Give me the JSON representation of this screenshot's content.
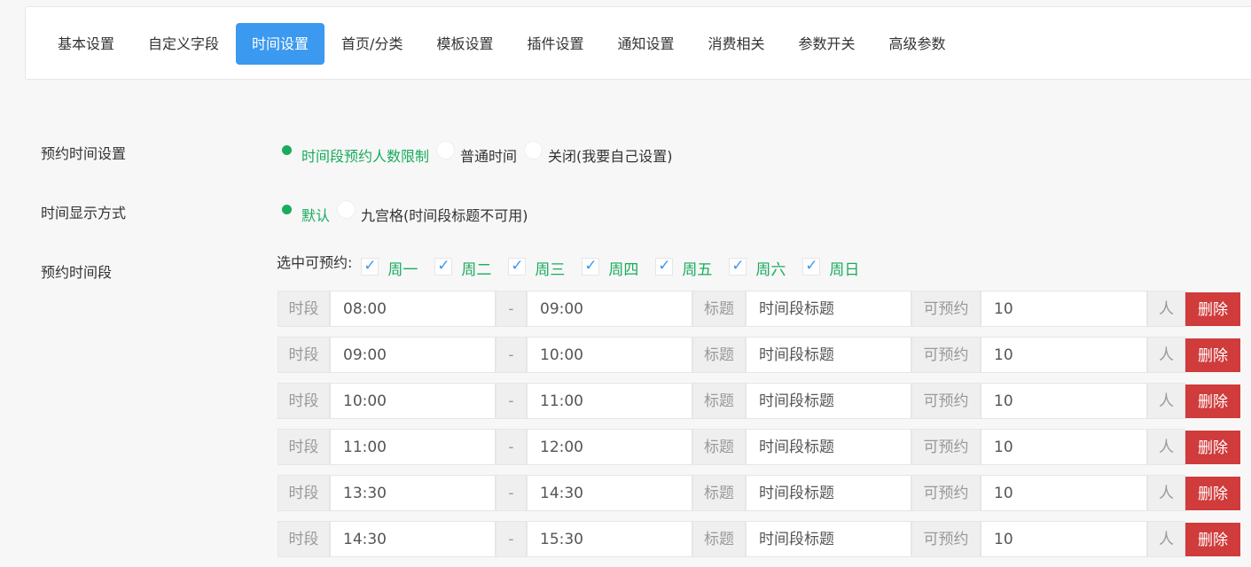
{
  "tabs": [
    {
      "label": "基本设置",
      "active": false
    },
    {
      "label": "自定义字段",
      "active": false
    },
    {
      "label": "时间设置",
      "active": true
    },
    {
      "label": "首页/分类",
      "active": false
    },
    {
      "label": "模板设置",
      "active": false
    },
    {
      "label": "插件设置",
      "active": false
    },
    {
      "label": "通知设置",
      "active": false
    },
    {
      "label": "消费相关",
      "active": false
    },
    {
      "label": "参数开关",
      "active": false
    },
    {
      "label": "高级参数",
      "active": false
    }
  ],
  "booking_time": {
    "label": "预约时间设置",
    "options": [
      "时间段预约人数限制",
      "普通时间",
      "关闭(我要自己设置)"
    ],
    "selected": 0
  },
  "display_mode": {
    "label": "时间显示方式",
    "options": [
      "默认",
      "九宫格(时间段标题不可用)"
    ],
    "selected": 0
  },
  "slots_section": {
    "label": "预约时间段",
    "days_label": "选中可预约:",
    "days": [
      "周一",
      "周二",
      "周三",
      "周四",
      "周五",
      "周六",
      "周日"
    ],
    "check_glyph": "✓"
  },
  "slot_labels": {
    "period": "时段",
    "separator": "-",
    "title": "标题",
    "title_placeholder": "时间段标题",
    "bookable": "可预约",
    "unit": "人",
    "delete": "删除"
  },
  "slots": [
    {
      "start": "08:00",
      "end": "09:00",
      "count": "10"
    },
    {
      "start": "09:00",
      "end": "10:00",
      "count": "10"
    },
    {
      "start": "10:00",
      "end": "11:00",
      "count": "10"
    },
    {
      "start": "11:00",
      "end": "12:00",
      "count": "10"
    },
    {
      "start": "13:30",
      "end": "14:30",
      "count": "10"
    },
    {
      "start": "14:30",
      "end": "15:30",
      "count": "10"
    }
  ],
  "colors": {
    "accent": "#3b99f0",
    "success": "#1aab5e",
    "danger": "#d03b3b"
  }
}
